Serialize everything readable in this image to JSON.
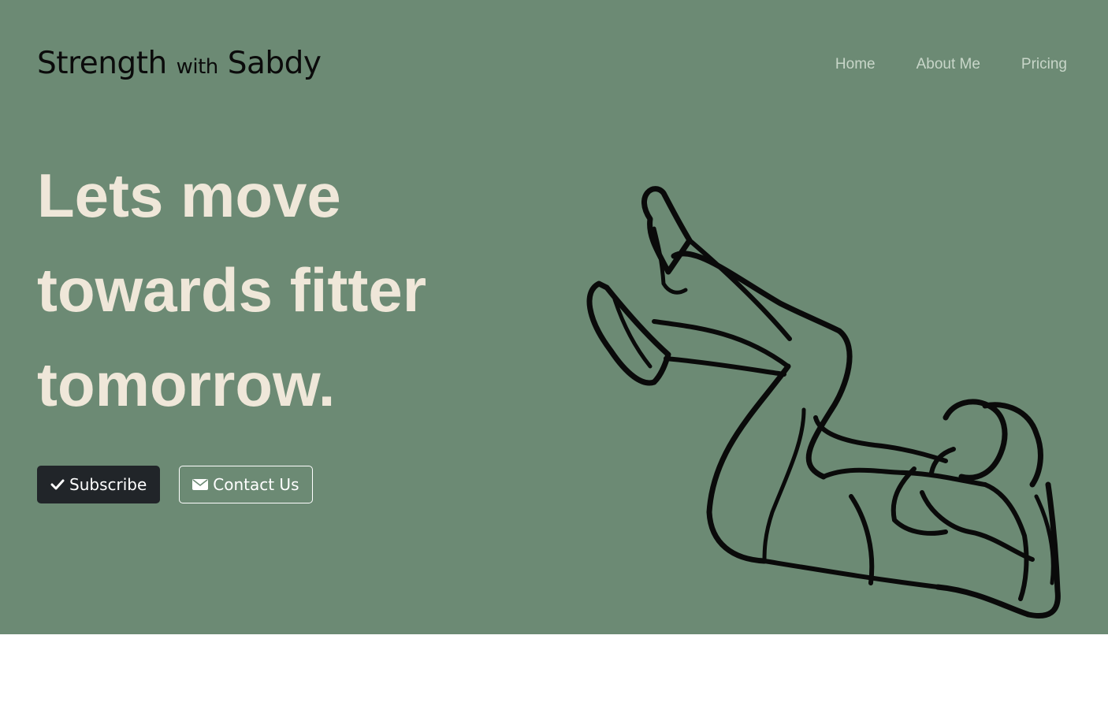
{
  "brand": {
    "part1": "Strength",
    "part2": "with",
    "part3": "Sabdy"
  },
  "nav": {
    "home": "Home",
    "about": "About Me",
    "pricing": "Pricing"
  },
  "hero": {
    "line1": "Lets move",
    "line2": "towards fitter",
    "line3": "tomorrow.",
    "subscribe_label": "Subscribe",
    "contact_label": "Contact Us"
  },
  "colors": {
    "hero_bg": "#6c8a74",
    "headline": "#efe7d9",
    "dark_button": "#212529",
    "nav_text": "#c8d6c9"
  },
  "icons": {
    "subscribe": "check-icon",
    "contact": "envelope-icon",
    "illustration": "crunch-exercise-illustration"
  }
}
